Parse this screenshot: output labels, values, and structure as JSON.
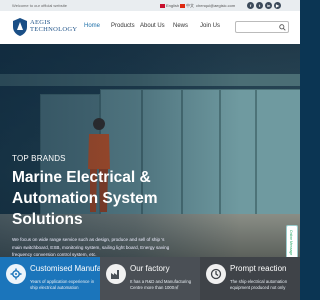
{
  "topbar": {
    "welcome": "Welcome to our official website",
    "languages": [
      {
        "label": "English",
        "flag": "#c8102e"
      },
      {
        "label": "中文",
        "flag": "#de2910"
      }
    ],
    "email": "chenqui@aegisic.com",
    "socials": [
      {
        "icon": "facebook-icon",
        "glyph": "f"
      },
      {
        "icon": "twitter-icon",
        "glyph": "t"
      },
      {
        "icon": "linkedin-icon",
        "glyph": "in"
      },
      {
        "icon": "youtube-icon",
        "glyph": "▶"
      }
    ]
  },
  "header": {
    "brand_line1": "AEGIS",
    "brand_line2": "TECHNOLOGY",
    "nav": [
      {
        "label": "Home",
        "active": true
      },
      {
        "label": "Products",
        "active": false
      },
      {
        "label": "About Us",
        "active": false
      },
      {
        "label": "News",
        "active": false
      },
      {
        "label": "Join Us",
        "active": false
      }
    ],
    "search_placeholder": ""
  },
  "hero": {
    "kicker": "TOP BRANDS",
    "title": "Marine Electrical & Automation System Solutions",
    "description": "We focus on wide range service such as design, produce and sell of ship 's main switchboard, ESB, monitoring system, sailing light board, Energy saving frequency conversion control system, etc.",
    "side_tab": "Online Message"
  },
  "features": [
    {
      "title": "Customised Manufa...",
      "text": "Years of application experience in ship electrical automation",
      "icon": "settings-icon",
      "color": "#1b75bb"
    },
    {
      "title": "Our factory",
      "text": "It has a R&D and Manufacturing Centre more than 1000㎡",
      "icon": "factory-icon",
      "color": "#4a4f55"
    },
    {
      "title": "Prompt reaction",
      "text": "The ship electrical automation equipment produced not only",
      "icon": "clock-icon",
      "color": "#3f4348"
    }
  ],
  "colors": {
    "accent": "#1d6fa8",
    "brand": "#1a4f86"
  }
}
